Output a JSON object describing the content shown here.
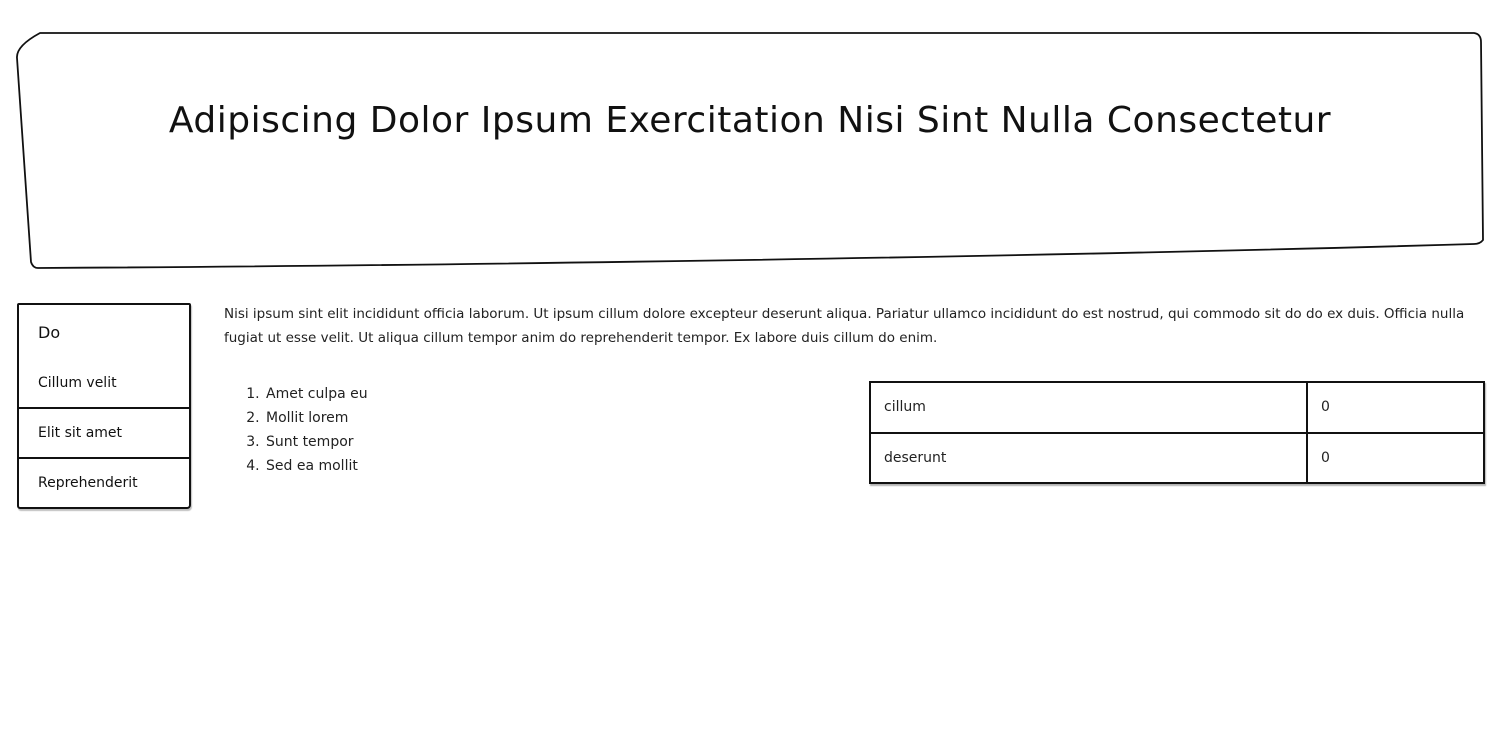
{
  "header": {
    "title": "Adipiscing Dolor Ipsum Exercitation Nisi Sint Nulla Consectetur"
  },
  "sidebar": {
    "heading": "Do",
    "items": [
      {
        "label": "Cillum velit"
      },
      {
        "label": "Elit sit amet"
      },
      {
        "label": "Reprehenderit"
      }
    ]
  },
  "main": {
    "paragraph": "Nisi ipsum sint elit incididunt officia laborum. Ut ipsum cillum dolore excepteur deserunt aliqua. Pariatur ullamco incididunt do est nostrud, qui commodo sit do do ex duis. Officia nulla fugiat ut esse velit. Ut aliqua cillum tempor anim do reprehenderit tempor. Ex labore duis cillum do enim.",
    "list": [
      "Amet culpa eu",
      "Mollit lorem",
      "Sunt tempor",
      "Sed ea mollit"
    ],
    "table": {
      "rows": [
        {
          "label": "cillum",
          "value": "0"
        },
        {
          "label": "deserunt",
          "value": "0"
        }
      ]
    }
  }
}
